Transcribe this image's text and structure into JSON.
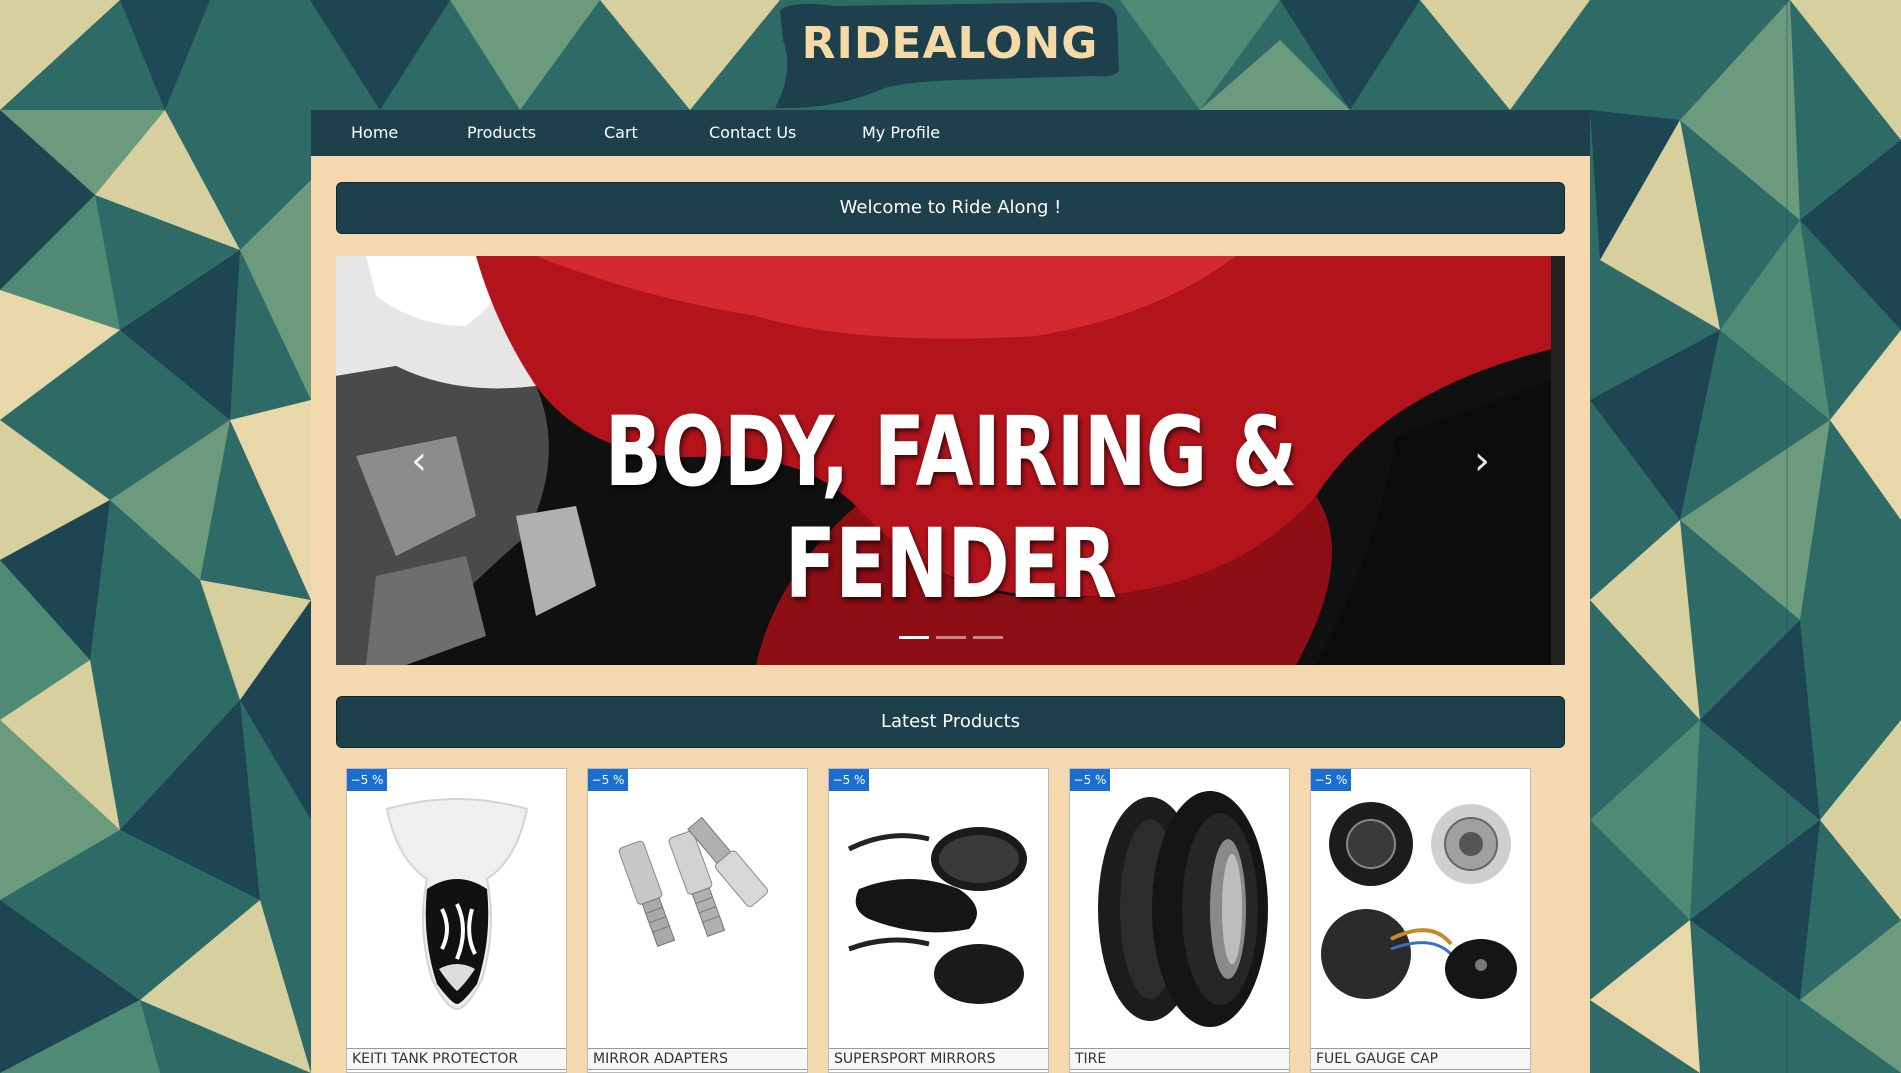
{
  "brand": {
    "name": "RIDEALONG"
  },
  "nav": {
    "items": [
      {
        "label": "Home"
      },
      {
        "label": "Products"
      },
      {
        "label": "Cart"
      },
      {
        "label": "Contact Us"
      },
      {
        "label": "My Profile"
      }
    ]
  },
  "welcome": {
    "text": "Welcome to Ride Along !"
  },
  "slider": {
    "caption": "BODY, FAIRING & FENDER",
    "prev_icon": "chevron-left-icon",
    "next_icon": "chevron-right-icon",
    "slide_count": 3,
    "active_index": 0
  },
  "latest": {
    "title": "Latest Products"
  },
  "products": [
    {
      "badge": "−5 %",
      "name": "KEITI TANK PROTECTOR",
      "image": "tank-protector"
    },
    {
      "badge": "−5 %",
      "name": "MIRROR ADAPTERS",
      "image": "mirror-adapters"
    },
    {
      "badge": "−5 %",
      "name": "SUPERSPORT MIRRORS",
      "image": "supersport-mirrors"
    },
    {
      "badge": "−5 %",
      "name": "TIRE",
      "image": "tire"
    },
    {
      "badge": "−5 %",
      "name": "FUEL GAUGE CAP",
      "image": "fuel-gauge-cap"
    }
  ],
  "colors": {
    "nav_bg": "#1e3f4c",
    "content_bg": "#f3d9ad",
    "badge_bg": "#1a6ed0",
    "logo_text": "#f5d9a6"
  }
}
